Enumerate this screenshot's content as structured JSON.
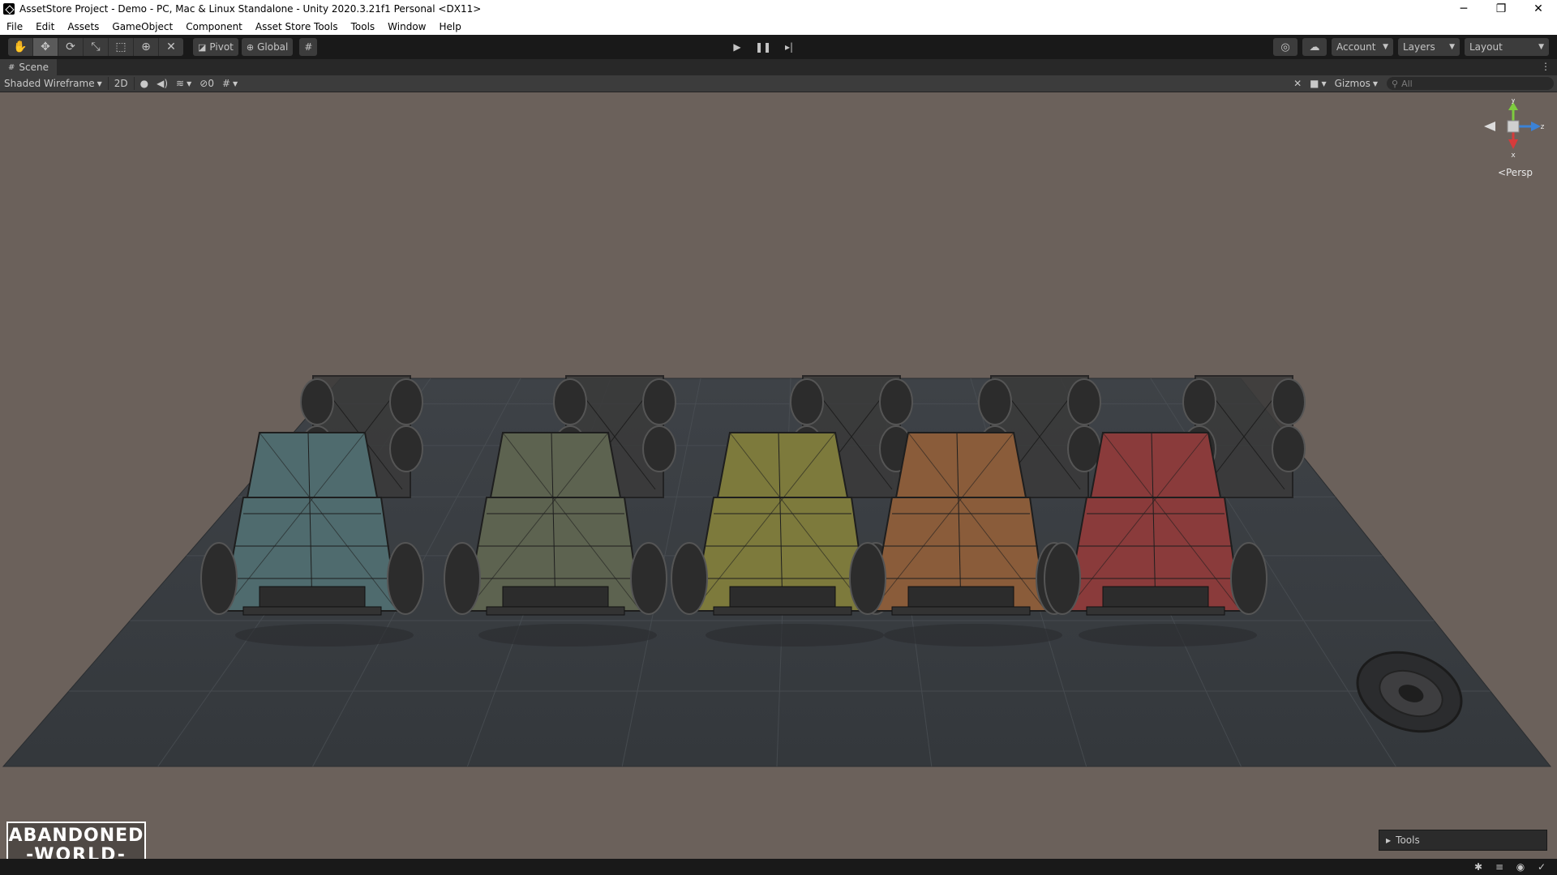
{
  "window": {
    "title": "AssetStore Project - Demo - PC, Mac & Linux Standalone - Unity 2020.3.21f1 Personal <DX11>",
    "minimize": "─",
    "restore": "❐",
    "close": "✕"
  },
  "menu": [
    "File",
    "Edit",
    "Assets",
    "GameObject",
    "Component",
    "Asset Store Tools",
    "Tools",
    "Window",
    "Help"
  ],
  "toolbar": {
    "pivot_label": "Pivot",
    "global_label": "Global",
    "account_label": "Account",
    "layers_label": "Layers",
    "layout_label": "Layout"
  },
  "scene": {
    "tab_label": "Scene",
    "shading_mode": "Shaded Wireframe",
    "mode_2d": "2D",
    "hidden_count": "0",
    "gizmos_label": "Gizmos",
    "search_placeholder": "All",
    "persp_label": "Persp",
    "axis_y": "y",
    "axis_z": "z",
    "axis_x": "x"
  },
  "logo": {
    "line1": "ABANDONED",
    "line2": "-WORLD-"
  },
  "tools_panel": {
    "label": "Tools"
  },
  "trucks": [
    {
      "name": "blue-truck",
      "color": "#4f6b6e"
    },
    {
      "name": "green-truck",
      "color": "#5d6350"
    },
    {
      "name": "yellow-truck",
      "color": "#7d7a3c"
    },
    {
      "name": "orange-truck",
      "color": "#8a5c3a"
    },
    {
      "name": "red-truck",
      "color": "#8a3b3b"
    }
  ]
}
